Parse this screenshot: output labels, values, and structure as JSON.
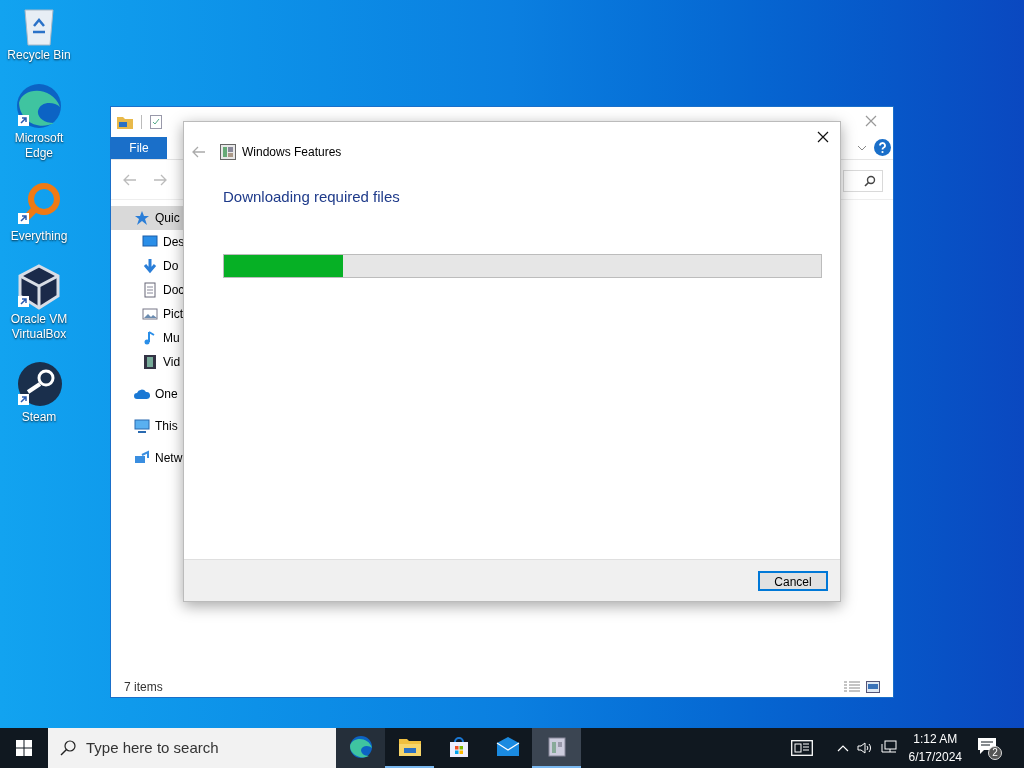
{
  "desktop_icons": [
    {
      "kind": "recycle",
      "label": "Recycle Bin"
    },
    {
      "kind": "edge",
      "label": "Microsoft Edge"
    },
    {
      "kind": "everything",
      "label": "Everything"
    },
    {
      "kind": "virtualbox",
      "label": "Oracle VM VirtualBox"
    },
    {
      "kind": "steam",
      "label": "Steam"
    }
  ],
  "explorer": {
    "ribbon_tabs": [
      {
        "label": "File",
        "selected": true
      }
    ],
    "nav_items": [
      {
        "kind": "star",
        "label": "Quic",
        "selected": true,
        "children": [
          {
            "kind": "desktop",
            "label": "Des",
            "selected": false
          },
          {
            "kind": "download",
            "label": "Do",
            "selected": false
          },
          {
            "kind": "document",
            "label": "Doc",
            "selected": false
          },
          {
            "kind": "pictures",
            "label": "Pict",
            "selected": false
          },
          {
            "kind": "music",
            "label": "Mu",
            "selected": false
          },
          {
            "kind": "video",
            "label": "Vid",
            "selected": false
          }
        ]
      },
      {
        "kind": "cloud",
        "label": "One",
        "selected": false
      },
      {
        "kind": "pc",
        "label": "This",
        "selected": false
      },
      {
        "kind": "network",
        "label": "Netw",
        "selected": false
      }
    ],
    "status_bar": "7 items"
  },
  "dialog": {
    "title": "Windows Features",
    "heading": "Downloading required files",
    "progress": {
      "level": 0.2
    },
    "buttons": [
      "Cancel"
    ]
  },
  "taskbar": {
    "search": {
      "placeholder": "Type here to search"
    },
    "apps": [
      {
        "kind": "edge",
        "running": false,
        "active": false
      },
      {
        "kind": "folder",
        "running": true,
        "active": false
      },
      {
        "kind": "store",
        "running": false,
        "active": false
      },
      {
        "kind": "mail",
        "running": false,
        "active": false
      },
      {
        "kind": "features",
        "running": true,
        "active": true
      }
    ],
    "time": "1:12 AM",
    "date": "6/17/2024",
    "notification_count": "2"
  }
}
